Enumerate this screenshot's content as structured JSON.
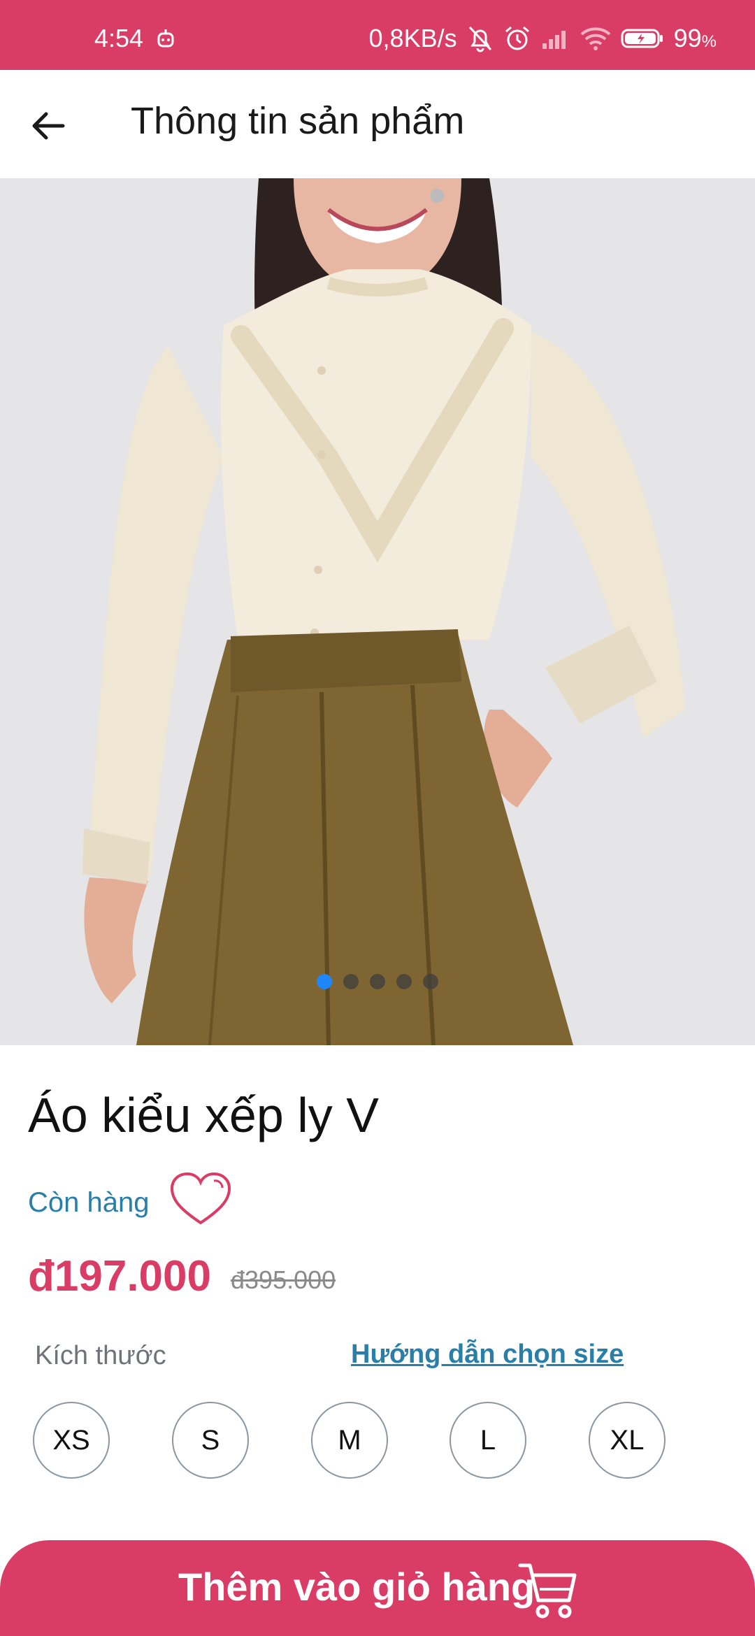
{
  "status_bar": {
    "time": "4:54",
    "net_speed": "0,8KB/s",
    "battery": "99",
    "battery_unit": "%"
  },
  "app_bar": {
    "title": "Thông tin sản phẩm",
    "back_icon": "arrow-left-icon"
  },
  "gallery": {
    "image_count": 5,
    "active_index": 0,
    "image_description": "Model wearing cream ruffle blouse and olive pleated skirt"
  },
  "product": {
    "name": "Áo kiểu xếp ly V",
    "stock_status": "Còn hàng",
    "price": "đ197.000",
    "original_price": "đ395.000",
    "favorite_icon": "heart-icon"
  },
  "size_section": {
    "label": "Kích thước",
    "guide_link": "Hướng dẫn chọn size",
    "options": [
      "XS",
      "S",
      "M",
      "L",
      "XL"
    ]
  },
  "cart_button": {
    "label": "Thêm vào giỏ hàng",
    "icon": "cart-icon"
  },
  "colors": {
    "brand": "#d93d66",
    "link": "#2a7fa8",
    "dot_active": "#1e86ff"
  }
}
